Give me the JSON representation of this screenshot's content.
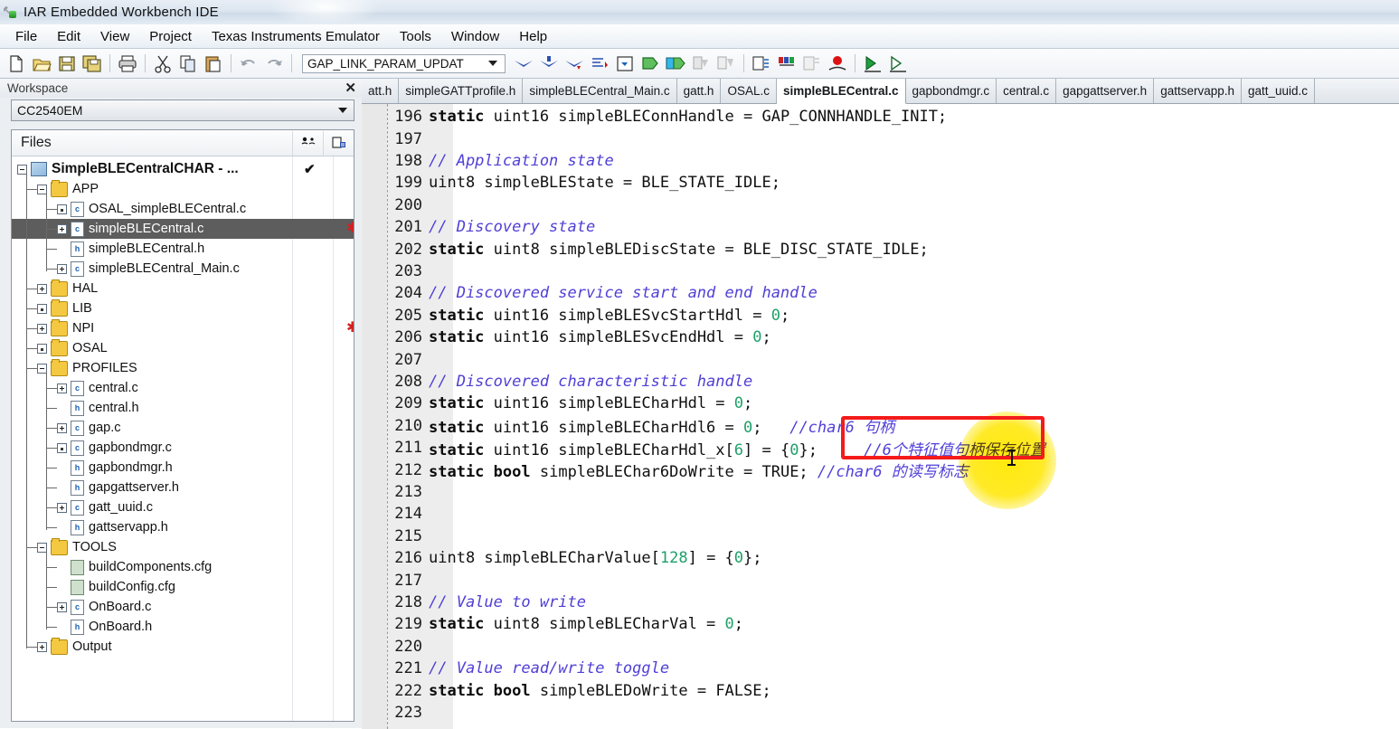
{
  "window": {
    "title": "IAR Embedded Workbench IDE",
    "icon": "wrench-tool-icon",
    "close_label": "✕"
  },
  "menu": {
    "items": [
      "File",
      "Edit",
      "View",
      "Project",
      "Texas Instruments Emulator",
      "Tools",
      "Window",
      "Help"
    ]
  },
  "toolbar": {
    "combo_value": "GAP_LINK_PARAM_UPDAT",
    "icons": [
      "new-document-icon",
      "open-folder-icon",
      "save-icon",
      "save-all-icon",
      "print-icon",
      "cut-icon",
      "copy-icon",
      "paste-icon",
      "undo-icon",
      "redo-icon"
    ],
    "debug_icons": [
      "go-to-definition-icon",
      "navigate-backward-icon",
      "navigate-forward-icon",
      "find-next-icon",
      "bookmark-toggle-icon",
      "compile-icon",
      "make-icon",
      "stop-build-icon",
      "build-all-icon",
      "debug-log-icon",
      "variables-icon",
      "disassembly-icon",
      "breakpoint-icon",
      "run-icon",
      "step-icon"
    ]
  },
  "workspace": {
    "panel_title": "Workspace",
    "config_value": "CC2540EM",
    "files_header": "Files",
    "header_icons": [
      "toggle-group-icon",
      "properties-icon"
    ],
    "tree": [
      {
        "label": "SimpleBLECentralCHAR - ...",
        "depth": 0,
        "icon": "project-icon",
        "twisty": "minus",
        "bold": true,
        "check": true,
        "selected": false,
        "asterisk": false
      },
      {
        "label": "APP",
        "depth": 1,
        "icon": "folder-icon",
        "twisty": "minus",
        "bold": false,
        "check": false,
        "selected": false,
        "asterisk": false
      },
      {
        "label": "OSAL_simpleBLECentral.c",
        "depth": 2,
        "icon": "c-file-icon",
        "twisty": "plus-small",
        "bold": false,
        "check": false,
        "selected": false,
        "asterisk": false
      },
      {
        "label": "simpleBLECentral.c",
        "depth": 2,
        "icon": "c-file-icon",
        "twisty": "plus",
        "bold": false,
        "check": false,
        "selected": true,
        "asterisk": true
      },
      {
        "label": "simpleBLECentral.h",
        "depth": 2,
        "icon": "h-file-icon",
        "twisty": "none",
        "bold": false,
        "check": false,
        "selected": false,
        "asterisk": false
      },
      {
        "label": "simpleBLECentral_Main.c",
        "depth": 2,
        "icon": "c-file-icon",
        "twisty": "plus",
        "bold": false,
        "check": false,
        "selected": false,
        "asterisk": false
      },
      {
        "label": "HAL",
        "depth": 1,
        "icon": "folder-icon",
        "twisty": "plus",
        "bold": false,
        "check": false,
        "selected": false,
        "asterisk": false
      },
      {
        "label": "LIB",
        "depth": 1,
        "icon": "folder-icon",
        "twisty": "plus-small",
        "bold": false,
        "check": false,
        "selected": false,
        "asterisk": false
      },
      {
        "label": "NPI",
        "depth": 1,
        "icon": "folder-icon",
        "twisty": "plus",
        "bold": false,
        "check": false,
        "selected": false,
        "asterisk": true
      },
      {
        "label": "OSAL",
        "depth": 1,
        "icon": "folder-icon",
        "twisty": "plus-small",
        "bold": false,
        "check": false,
        "selected": false,
        "asterisk": false
      },
      {
        "label": "PROFILES",
        "depth": 1,
        "icon": "folder-icon",
        "twisty": "minus",
        "bold": false,
        "check": false,
        "selected": false,
        "asterisk": false
      },
      {
        "label": "central.c",
        "depth": 2,
        "icon": "c-file-icon",
        "twisty": "plus",
        "bold": false,
        "check": false,
        "selected": false,
        "asterisk": false
      },
      {
        "label": "central.h",
        "depth": 2,
        "icon": "h-file-icon",
        "twisty": "none",
        "bold": false,
        "check": false,
        "selected": false,
        "asterisk": false
      },
      {
        "label": "gap.c",
        "depth": 2,
        "icon": "c-file-icon",
        "twisty": "plus",
        "bold": false,
        "check": false,
        "selected": false,
        "asterisk": false
      },
      {
        "label": "gapbondmgr.c",
        "depth": 2,
        "icon": "c-file-icon",
        "twisty": "plus-small",
        "bold": false,
        "check": false,
        "selected": false,
        "asterisk": false
      },
      {
        "label": "gapbondmgr.h",
        "depth": 2,
        "icon": "h-file-icon",
        "twisty": "none",
        "bold": false,
        "check": false,
        "selected": false,
        "asterisk": false
      },
      {
        "label": "gapgattserver.h",
        "depth": 2,
        "icon": "h-file-icon",
        "twisty": "none",
        "bold": false,
        "check": false,
        "selected": false,
        "asterisk": false
      },
      {
        "label": "gatt_uuid.c",
        "depth": 2,
        "icon": "c-file-icon",
        "twisty": "plus",
        "bold": false,
        "check": false,
        "selected": false,
        "asterisk": false
      },
      {
        "label": "gattservapp.h",
        "depth": 2,
        "icon": "h-file-icon",
        "twisty": "none",
        "bold": false,
        "check": false,
        "selected": false,
        "asterisk": false
      },
      {
        "label": "TOOLS",
        "depth": 1,
        "icon": "folder-icon",
        "twisty": "minus",
        "bold": false,
        "check": false,
        "selected": false,
        "asterisk": false
      },
      {
        "label": "buildComponents.cfg",
        "depth": 2,
        "icon": "cfg-file-icon",
        "twisty": "none",
        "bold": false,
        "check": false,
        "selected": false,
        "asterisk": false
      },
      {
        "label": "buildConfig.cfg",
        "depth": 2,
        "icon": "cfg-file-icon",
        "twisty": "none",
        "bold": false,
        "check": false,
        "selected": false,
        "asterisk": false
      },
      {
        "label": "OnBoard.c",
        "depth": 2,
        "icon": "c-file-icon",
        "twisty": "plus",
        "bold": false,
        "check": false,
        "selected": false,
        "asterisk": false
      },
      {
        "label": "OnBoard.h",
        "depth": 2,
        "icon": "h-file-icon",
        "twisty": "none",
        "bold": false,
        "check": false,
        "selected": false,
        "asterisk": false
      },
      {
        "label": "Output",
        "depth": 1,
        "icon": "folder-icon",
        "twisty": "plus",
        "bold": false,
        "check": false,
        "selected": false,
        "asterisk": false
      }
    ]
  },
  "editor": {
    "tabs": [
      {
        "label": "att.h",
        "active": false
      },
      {
        "label": "simpleGATTprofile.h",
        "active": false
      },
      {
        "label": "simpleBLECentral_Main.c",
        "active": false
      },
      {
        "label": "gatt.h",
        "active": false
      },
      {
        "label": "OSAL.c",
        "active": false
      },
      {
        "label": "simpleBLECentral.c",
        "active": true
      },
      {
        "label": "gapbondmgr.c",
        "active": false
      },
      {
        "label": "central.c",
        "active": false
      },
      {
        "label": "gapgattserver.h",
        "active": false
      },
      {
        "label": "gattservapp.h",
        "active": false
      },
      {
        "label": "gatt_uuid.c",
        "active": false
      }
    ],
    "lines": [
      {
        "n": "196",
        "segs": [
          {
            "t": "static",
            "c": "kw"
          },
          {
            "t": " uint16 simpleBLEConnHandle = GAP_CONNHANDLE_INIT;",
            "c": ""
          }
        ]
      },
      {
        "n": "197",
        "segs": []
      },
      {
        "n": "198",
        "segs": [
          {
            "t": "// Application state",
            "c": "cm"
          }
        ]
      },
      {
        "n": "199",
        "segs": [
          {
            "t": "uint8 simpleBLEState = BLE_STATE_IDLE;",
            "c": ""
          }
        ]
      },
      {
        "n": "200",
        "segs": []
      },
      {
        "n": "201",
        "segs": [
          {
            "t": "// Discovery state",
            "c": "cm"
          }
        ]
      },
      {
        "n": "202",
        "segs": [
          {
            "t": "static",
            "c": "kw"
          },
          {
            "t": " uint8 simpleBLEDiscState = BLE_DISC_STATE_IDLE;",
            "c": ""
          }
        ]
      },
      {
        "n": "203",
        "segs": []
      },
      {
        "n": "204",
        "segs": [
          {
            "t": "// Discovered service start and end handle",
            "c": "cm"
          }
        ]
      },
      {
        "n": "205",
        "segs": [
          {
            "t": "static",
            "c": "kw"
          },
          {
            "t": " uint16 simpleBLESvcStartHdl = ",
            "c": ""
          },
          {
            "t": "0",
            "c": "num"
          },
          {
            "t": ";",
            "c": ""
          }
        ]
      },
      {
        "n": "206",
        "segs": [
          {
            "t": "static",
            "c": "kw"
          },
          {
            "t": " uint16 simpleBLESvcEndHdl = ",
            "c": ""
          },
          {
            "t": "0",
            "c": "num"
          },
          {
            "t": ";",
            "c": ""
          }
        ]
      },
      {
        "n": "207",
        "segs": []
      },
      {
        "n": "208",
        "segs": [
          {
            "t": "// Discovered characteristic handle",
            "c": "cm"
          }
        ]
      },
      {
        "n": "209",
        "segs": [
          {
            "t": "static",
            "c": "kw"
          },
          {
            "t": " uint16 simpleBLECharHdl = ",
            "c": ""
          },
          {
            "t": "0",
            "c": "num"
          },
          {
            "t": ";",
            "c": ""
          }
        ]
      },
      {
        "n": "210",
        "segs": [
          {
            "t": "static",
            "c": "kw"
          },
          {
            "t": " uint16 simpleBLECharHdl6 = ",
            "c": ""
          },
          {
            "t": "0",
            "c": "num"
          },
          {
            "t": ";   ",
            "c": ""
          },
          {
            "t": "//char6 ",
            "c": "cm"
          },
          {
            "t": "句柄",
            "c": "cjk"
          }
        ]
      },
      {
        "n": "211",
        "segs": [
          {
            "t": "static",
            "c": "kw"
          },
          {
            "t": " uint16 simpleBLECharHdl_x[",
            "c": ""
          },
          {
            "t": "6",
            "c": "num"
          },
          {
            "t": "] = {",
            "c": ""
          },
          {
            "t": "0",
            "c": "num"
          },
          {
            "t": "};     ",
            "c": ""
          },
          {
            "t": "//6",
            "c": "cm"
          },
          {
            "t": "个特征值句柄保存位置",
            "c": "cjk"
          }
        ]
      },
      {
        "n": "212",
        "segs": [
          {
            "t": "static",
            "c": "kw"
          },
          {
            "t": " ",
            "c": ""
          },
          {
            "t": "bool",
            "c": "kw"
          },
          {
            "t": " simpleBLEChar6DoWrite = TRUE; ",
            "c": ""
          },
          {
            "t": "//char6 ",
            "c": "cm"
          },
          {
            "t": "的读写标志",
            "c": "cjk"
          }
        ]
      },
      {
        "n": "213",
        "segs": []
      },
      {
        "n": "214",
        "segs": []
      },
      {
        "n": "215",
        "segs": []
      },
      {
        "n": "216",
        "segs": [
          {
            "t": "uint8 simpleBLECharValue[",
            "c": ""
          },
          {
            "t": "128",
            "c": "num"
          },
          {
            "t": "] = {",
            "c": ""
          },
          {
            "t": "0",
            "c": "num"
          },
          {
            "t": "};",
            "c": ""
          }
        ]
      },
      {
        "n": "217",
        "segs": []
      },
      {
        "n": "218",
        "segs": [
          {
            "t": "// Value to write",
            "c": "cm"
          }
        ]
      },
      {
        "n": "219",
        "segs": [
          {
            "t": "static",
            "c": "kw"
          },
          {
            "t": " uint8 simpleBLECharVal = ",
            "c": ""
          },
          {
            "t": "0",
            "c": "num"
          },
          {
            "t": ";",
            "c": ""
          }
        ]
      },
      {
        "n": "220",
        "segs": []
      },
      {
        "n": "221",
        "segs": [
          {
            "t": "// Value read/write toggle",
            "c": "cm"
          }
        ]
      },
      {
        "n": "222",
        "segs": [
          {
            "t": "static",
            "c": "kw"
          },
          {
            "t": " ",
            "c": ""
          },
          {
            "t": "bool",
            "c": "kw"
          },
          {
            "t": " simpleBLEDoWrite = FALSE;",
            "c": ""
          }
        ]
      },
      {
        "n": "223",
        "segs": []
      }
    ]
  },
  "annotations": {
    "red_box_color": "#f51b1b",
    "highlight_color": "#ffe800",
    "cursor": "text-ibeam-cursor"
  },
  "colors": {
    "keyword": "#0b0b0b",
    "comment": "#4f3fd6",
    "number": "#1f9f6a",
    "selection": "#5d5d5d",
    "marker_red": "#d42020"
  }
}
